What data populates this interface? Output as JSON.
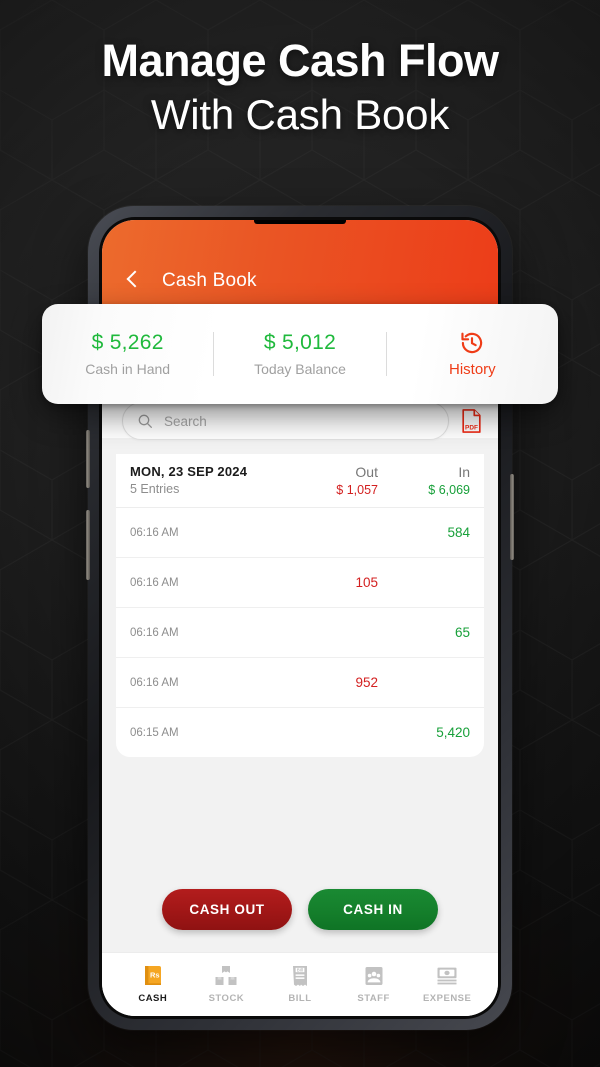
{
  "headline": {
    "line1": "Manage Cash Flow",
    "line2": "With Cash Book"
  },
  "appbar": {
    "back_icon": "chevron-left-icon",
    "title": "Cash Book"
  },
  "summary": {
    "cash_in_hand": {
      "value": "$ 5,262",
      "label": "Cash in Hand"
    },
    "today_balance": {
      "value": "$ 5,012",
      "label": "Today Balance"
    },
    "history": {
      "icon": "history-icon",
      "label": "History"
    }
  },
  "search": {
    "icon": "search-icon",
    "placeholder": "Search",
    "value": "",
    "pdf_icon": "pdf-export-icon"
  },
  "day_header": {
    "date": "MON, 23 SEP 2024",
    "entries": "5 Entries",
    "out_label": "Out",
    "out_total": "$ 1,057",
    "in_label": "In",
    "in_total": "$ 6,069"
  },
  "transactions": [
    {
      "time": "06:16 AM",
      "out": "",
      "in": "584"
    },
    {
      "time": "06:16 AM",
      "out": "105",
      "in": ""
    },
    {
      "time": "06:16 AM",
      "out": "",
      "in": "65"
    },
    {
      "time": "06:16 AM",
      "out": "952",
      "in": ""
    },
    {
      "time": "06:15 AM",
      "out": "",
      "in": "5,420"
    }
  ],
  "actions": {
    "cash_out": "CASH OUT",
    "cash_in": "CASH IN"
  },
  "bottom_nav": [
    {
      "label": "CASH",
      "icon": "cash-book-icon",
      "active": true
    },
    {
      "label": "STOCK",
      "icon": "boxes-icon",
      "active": false
    },
    {
      "label": "BILL",
      "icon": "receipt-icon",
      "active": false
    },
    {
      "label": "STAFF",
      "icon": "staff-icon",
      "active": false
    },
    {
      "label": "EXPENSE",
      "icon": "banknote-icon",
      "active": false
    }
  ],
  "colors": {
    "brand_orange": "#ec5524",
    "green": "#18a03a",
    "red": "#d32020",
    "cash_out_red": "#a21717",
    "cash_in_green": "#15802c",
    "backdrop": "#1c1c1c"
  }
}
